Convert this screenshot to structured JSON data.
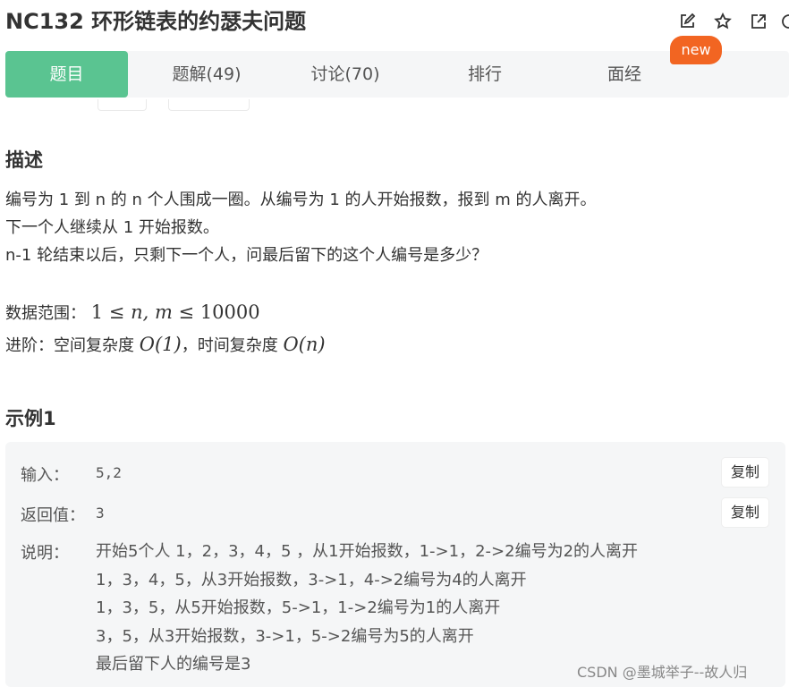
{
  "problem": {
    "title": "NC132  环形链表的约瑟夫问题"
  },
  "title_icons": [
    "edit-icon",
    "star-icon",
    "share-icon",
    "more-icon"
  ],
  "tabs": [
    {
      "label": "题目"
    },
    {
      "label": "题解(49)"
    },
    {
      "label": "讨论(70)"
    },
    {
      "label": "排行"
    },
    {
      "label": "面经"
    }
  ],
  "new_badge": "new",
  "colors": {
    "active_tab": "#5ac491",
    "badge": "#f26522"
  },
  "description": {
    "heading": "描述",
    "lines": [
      "编号为 1 到 n 的 n 个人围成一圈。从编号为 1 的人开始报数，报到 m 的人离开。",
      "下一个人继续从 1 开始报数。",
      "n-1 轮结束以后，只剩下一个人，问最后留下的这个人编号是多少？"
    ],
    "range_label": "数据范围：",
    "range_math": {
      "low": "1",
      "vars": "n, m",
      "high": "10000"
    },
    "advanced_label": "进阶：空间复杂度",
    "space": "O(1)",
    "time_label": "，时间复杂度",
    "time": "O(n)"
  },
  "example": {
    "heading": "示例1",
    "input_label": "输入：",
    "input_value": "5,2",
    "output_label": "返回值：",
    "output_value": "3",
    "copy_label": "复制",
    "explain_label": "说明：",
    "explain_lines": [
      "开始5个人 1，2，3，4，5 ，从1开始报数，1->1，2->2编号为2的人离开",
      "1，3，4，5，从3开始报数，3->1，4->2编号为4的人离开",
      "1，3，5，从5开始报数，5->1，1->2编号为1的人离开",
      "3，5，从3开始报数，3->1，5->2编号为5的人离开",
      "最后留下人的编号是3"
    ]
  },
  "watermark": "CSDN @墨城举子--故人归"
}
